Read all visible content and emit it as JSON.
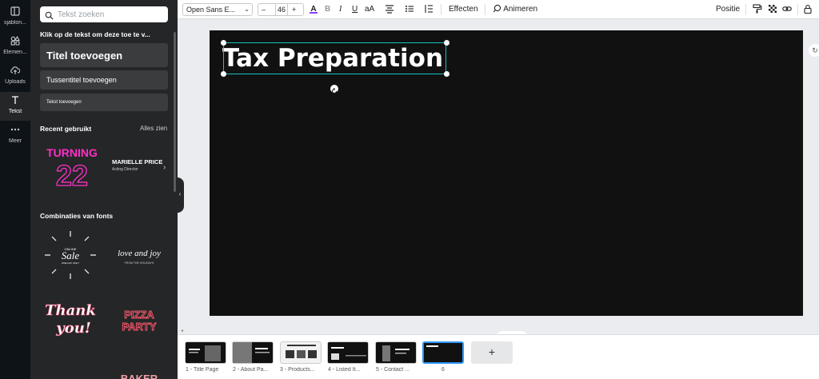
{
  "rail": {
    "items": [
      {
        "label": "sjablon...",
        "icon": "template-icon"
      },
      {
        "label": "Elemen...",
        "icon": "elements-icon"
      },
      {
        "label": "Uploads",
        "icon": "upload-icon"
      },
      {
        "label": "Tekst",
        "icon": "text-icon",
        "active": true
      },
      {
        "label": "Meer",
        "icon": "more-icon"
      }
    ]
  },
  "panel": {
    "search_placeholder": "Tekst zoeken",
    "hint": "Klik op de tekst om deze toe te v...",
    "title_btn": "Titel toevoegen",
    "subtitle_btn": "Tussentitel toevoegen",
    "body_btn": "Tekst toevoegen",
    "recent_heading": "Recent gebruikt",
    "see_all": "Alles zien",
    "fonts_heading": "Combinaties van fonts",
    "recent": {
      "turning_line1": "TURNING",
      "turning_line2": "22",
      "name": "MARIELLE PRICE",
      "role": "Acting Director"
    },
    "combos": {
      "sale_small": "ONLINE",
      "sale_big": "Sale",
      "sale_tag": "ONE DAY ONLY",
      "love": "love and joy",
      "love_sub": "FROM THE HOLIDAYS",
      "thank": "Thank",
      "you": "you!",
      "pizza": "PIZZA",
      "party": "PARTY",
      "baker": "BAKER"
    }
  },
  "toolbar": {
    "font": "Open Sans E...",
    "minus": "–",
    "size": "46",
    "plus": "+",
    "case": "aA",
    "effects": "Effecten",
    "animate": "Animeren",
    "position": "Positie",
    "accent_color": "#8b3dff"
  },
  "canvas": {
    "title": "Tax Preparation",
    "selection_color": "#13c4c1"
  },
  "pages": [
    {
      "label": "1 - Title Page"
    },
    {
      "label": "2 - About Pa..."
    },
    {
      "label": "3 - Products..."
    },
    {
      "label": "4 - Listed It..."
    },
    {
      "label": "5 - Contact ..."
    },
    {
      "label": "6",
      "active": true
    }
  ],
  "add_page": "+"
}
